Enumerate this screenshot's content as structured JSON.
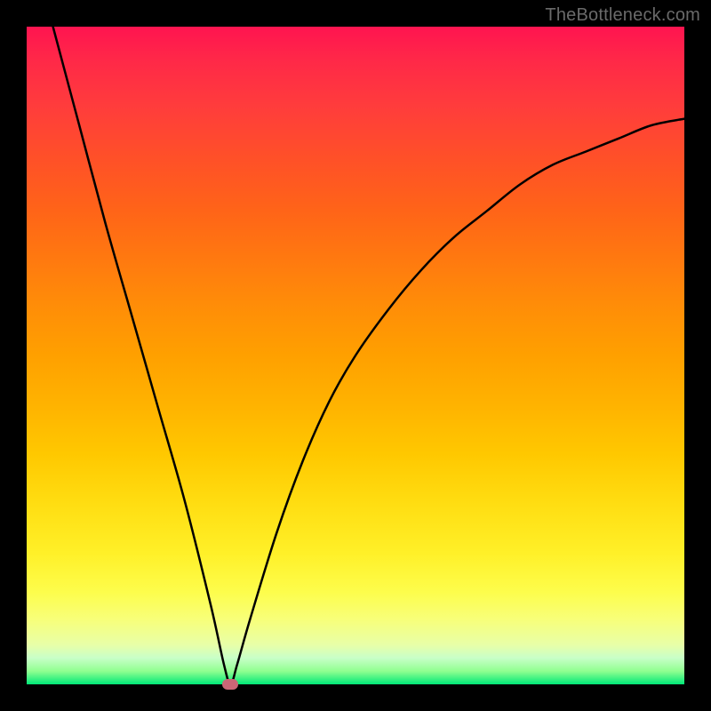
{
  "watermark": "TheBottleneck.com",
  "chart_data": {
    "type": "line",
    "title": "",
    "xlabel": "",
    "ylabel": "",
    "xlim": [
      0,
      100
    ],
    "ylim": [
      0,
      100
    ],
    "grid": false,
    "annotations": [
      {
        "name": "optimum-marker",
        "x": 31,
        "y": 0
      }
    ],
    "series": [
      {
        "name": "bottleneck-curve",
        "color": "#000000",
        "x": [
          4,
          8,
          12,
          16,
          20,
          24,
          28,
          30,
          31,
          32,
          34,
          38,
          42,
          46,
          50,
          55,
          60,
          65,
          70,
          75,
          80,
          85,
          90,
          95,
          100
        ],
        "y": [
          100,
          85,
          70,
          56,
          42,
          28,
          12,
          3,
          0,
          3,
          10,
          23,
          34,
          43,
          50,
          57,
          63,
          68,
          72,
          76,
          79,
          81,
          83,
          85,
          86
        ]
      }
    ]
  },
  "colors": {
    "background": "#000000",
    "gradient_top": "#ff1450",
    "gradient_bottom": "#00e878",
    "curve": "#000000",
    "marker": "#cc6677",
    "watermark": "#6a6a6a"
  }
}
